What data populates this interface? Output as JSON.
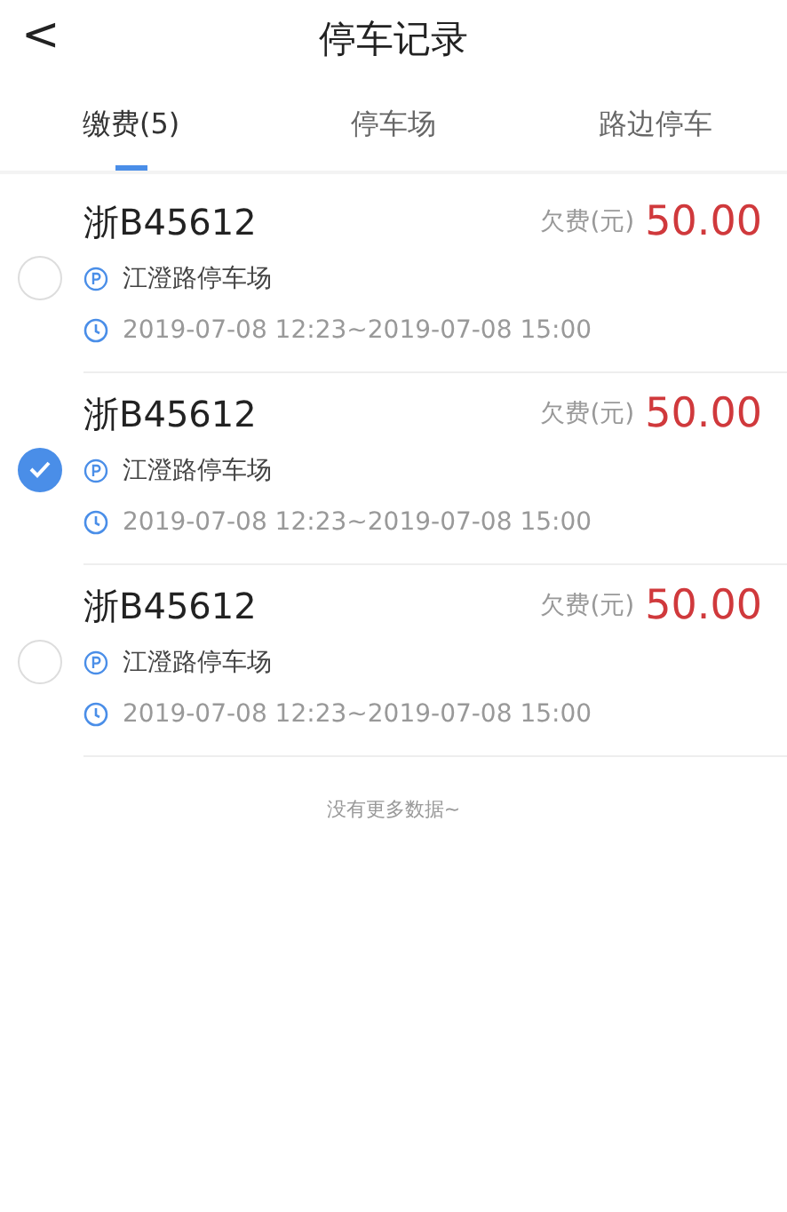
{
  "header": {
    "back_glyph": "<",
    "title": "停车记录"
  },
  "tabs": [
    {
      "label": "缴费(5)",
      "selected": true
    },
    {
      "label": "停车场",
      "selected": false
    },
    {
      "label": "路边停车",
      "selected": false
    }
  ],
  "records": [
    {
      "plate": "浙B45612",
      "selected": false,
      "place": "江澄路停车场",
      "time": "2019-07-08 12:23~2019-07-08 15:00",
      "fee_label": "欠费(元)",
      "amount": "50.00"
    },
    {
      "plate": "浙B45612",
      "selected": true,
      "place": "江澄路停车场",
      "time": "2019-07-08 12:23~2019-07-08 15:00",
      "fee_label": "欠费(元)",
      "amount": "50.00"
    },
    {
      "plate": "浙B45612",
      "selected": false,
      "place": "江澄路停车场",
      "time": "2019-07-08 12:23~2019-07-08 15:00",
      "fee_label": "欠费(元)",
      "amount": "50.00"
    }
  ],
  "footer": "没有更多数据~"
}
